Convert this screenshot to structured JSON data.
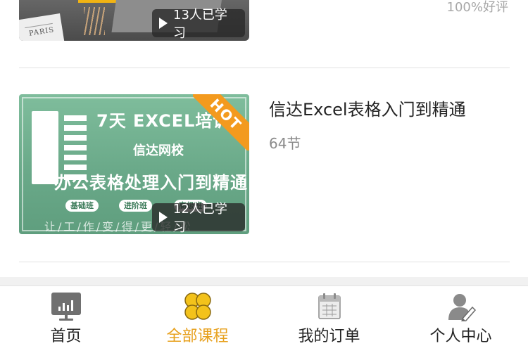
{
  "courses": [
    {
      "learners": "13人已学习",
      "rating": "100%好评",
      "thumb_text": "PARIS"
    },
    {
      "title": "信达Excel表格入门到精通",
      "lessons": "64节",
      "learners": "12人已学习",
      "thumbnail": {
        "headline": "7天 EXCEL培训",
        "school": "信达网校",
        "subtitle": "办公表格处理入门到精通",
        "levels": [
          "基础班",
          "进阶班",
          "高级班"
        ],
        "slogan": "让/工/作/变/得/更/轻/松",
        "hot_badge": "HOT"
      }
    }
  ],
  "tabbar": {
    "active_color": "#e7a01c",
    "items": [
      {
        "label": "首页",
        "icon": "home-chart-icon"
      },
      {
        "label": "全部课程",
        "icon": "all-courses-icon"
      },
      {
        "label": "我的订单",
        "icon": "calendar-orders-icon"
      },
      {
        "label": "个人中心",
        "icon": "user-profile-icon"
      }
    ],
    "active_index": 1
  }
}
